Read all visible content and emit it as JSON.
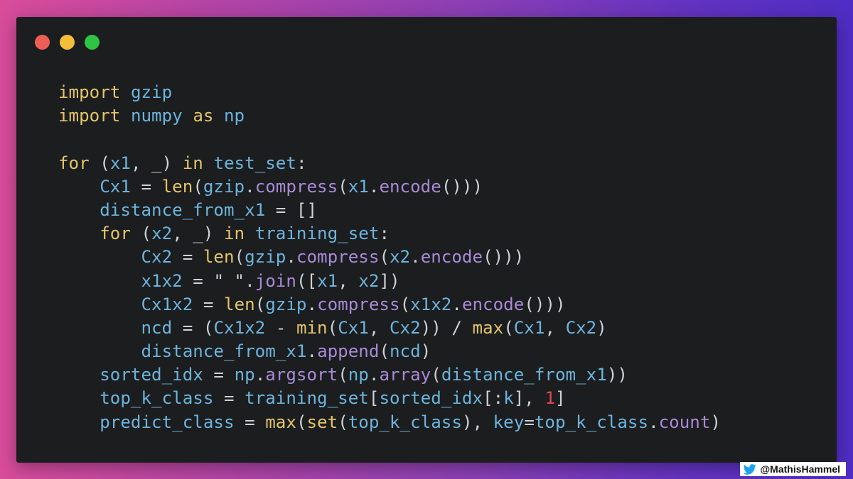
{
  "window": {
    "traffic_lights": [
      {
        "name": "close",
        "color": "#ed5f56"
      },
      {
        "name": "minimize",
        "color": "#f4bd3a"
      },
      {
        "name": "zoom",
        "color": "#2fc443"
      }
    ]
  },
  "code": {
    "lines": [
      [
        {
          "t": "import",
          "c": "kw"
        },
        {
          "t": " ",
          "c": "pn"
        },
        {
          "t": "gzip",
          "c": "id"
        }
      ],
      [
        {
          "t": "import",
          "c": "kw"
        },
        {
          "t": " ",
          "c": "pn"
        },
        {
          "t": "numpy",
          "c": "id"
        },
        {
          "t": " ",
          "c": "pn"
        },
        {
          "t": "as",
          "c": "kw"
        },
        {
          "t": " ",
          "c": "pn"
        },
        {
          "t": "np",
          "c": "id"
        }
      ],
      [],
      [
        {
          "t": "for",
          "c": "kw"
        },
        {
          "t": " (",
          "c": "pn"
        },
        {
          "t": "x1",
          "c": "id"
        },
        {
          "t": ", _) ",
          "c": "pn"
        },
        {
          "t": "in",
          "c": "kw"
        },
        {
          "t": " ",
          "c": "pn"
        },
        {
          "t": "test_set",
          "c": "id"
        },
        {
          "t": ":",
          "c": "pn"
        }
      ],
      [
        {
          "t": "    ",
          "c": "pn"
        },
        {
          "t": "Cx1",
          "c": "id"
        },
        {
          "t": " = ",
          "c": "pn"
        },
        {
          "t": "len",
          "c": "kw"
        },
        {
          "t": "(",
          "c": "pn"
        },
        {
          "t": "gzip",
          "c": "id"
        },
        {
          "t": ".",
          "c": "pn"
        },
        {
          "t": "compress",
          "c": "fn"
        },
        {
          "t": "(",
          "c": "pn"
        },
        {
          "t": "x1",
          "c": "id"
        },
        {
          "t": ".",
          "c": "pn"
        },
        {
          "t": "encode",
          "c": "fn"
        },
        {
          "t": "()))",
          "c": "pn"
        }
      ],
      [
        {
          "t": "    ",
          "c": "pn"
        },
        {
          "t": "distance_from_x1",
          "c": "id"
        },
        {
          "t": " = []",
          "c": "pn"
        }
      ],
      [
        {
          "t": "    ",
          "c": "pn"
        },
        {
          "t": "for",
          "c": "kw"
        },
        {
          "t": " (",
          "c": "pn"
        },
        {
          "t": "x2",
          "c": "id"
        },
        {
          "t": ", _) ",
          "c": "pn"
        },
        {
          "t": "in",
          "c": "kw"
        },
        {
          "t": " ",
          "c": "pn"
        },
        {
          "t": "training_set",
          "c": "id"
        },
        {
          "t": ":",
          "c": "pn"
        }
      ],
      [
        {
          "t": "        ",
          "c": "pn"
        },
        {
          "t": "Cx2",
          "c": "id"
        },
        {
          "t": " = ",
          "c": "pn"
        },
        {
          "t": "len",
          "c": "kw"
        },
        {
          "t": "(",
          "c": "pn"
        },
        {
          "t": "gzip",
          "c": "id"
        },
        {
          "t": ".",
          "c": "pn"
        },
        {
          "t": "compress",
          "c": "fn"
        },
        {
          "t": "(",
          "c": "pn"
        },
        {
          "t": "x2",
          "c": "id"
        },
        {
          "t": ".",
          "c": "pn"
        },
        {
          "t": "encode",
          "c": "fn"
        },
        {
          "t": "()))",
          "c": "pn"
        }
      ],
      [
        {
          "t": "        ",
          "c": "pn"
        },
        {
          "t": "x1x2",
          "c": "id"
        },
        {
          "t": " = ",
          "c": "pn"
        },
        {
          "t": "\" \"",
          "c": "st"
        },
        {
          "t": ".",
          "c": "pn"
        },
        {
          "t": "join",
          "c": "fn"
        },
        {
          "t": "([",
          "c": "pn"
        },
        {
          "t": "x1",
          "c": "id"
        },
        {
          "t": ", ",
          "c": "pn"
        },
        {
          "t": "x2",
          "c": "id"
        },
        {
          "t": "])",
          "c": "pn"
        }
      ],
      [
        {
          "t": "        ",
          "c": "pn"
        },
        {
          "t": "Cx1x2",
          "c": "id"
        },
        {
          "t": " = ",
          "c": "pn"
        },
        {
          "t": "len",
          "c": "kw"
        },
        {
          "t": "(",
          "c": "pn"
        },
        {
          "t": "gzip",
          "c": "id"
        },
        {
          "t": ".",
          "c": "pn"
        },
        {
          "t": "compress",
          "c": "fn"
        },
        {
          "t": "(",
          "c": "pn"
        },
        {
          "t": "x1x2",
          "c": "id"
        },
        {
          "t": ".",
          "c": "pn"
        },
        {
          "t": "encode",
          "c": "fn"
        },
        {
          "t": "()))",
          "c": "pn"
        }
      ],
      [
        {
          "t": "        ",
          "c": "pn"
        },
        {
          "t": "ncd",
          "c": "id"
        },
        {
          "t": " = (",
          "c": "pn"
        },
        {
          "t": "Cx1x2",
          "c": "id"
        },
        {
          "t": " - ",
          "c": "pn"
        },
        {
          "t": "min",
          "c": "kw"
        },
        {
          "t": "(",
          "c": "pn"
        },
        {
          "t": "Cx1",
          "c": "id"
        },
        {
          "t": ", ",
          "c": "pn"
        },
        {
          "t": "Cx2",
          "c": "id"
        },
        {
          "t": ")) / ",
          "c": "pn"
        },
        {
          "t": "max",
          "c": "kw"
        },
        {
          "t": "(",
          "c": "pn"
        },
        {
          "t": "Cx1",
          "c": "id"
        },
        {
          "t": ", ",
          "c": "pn"
        },
        {
          "t": "Cx2",
          "c": "id"
        },
        {
          "t": ")",
          "c": "pn"
        }
      ],
      [
        {
          "t": "        ",
          "c": "pn"
        },
        {
          "t": "distance_from_x1",
          "c": "id"
        },
        {
          "t": ".",
          "c": "pn"
        },
        {
          "t": "append",
          "c": "fn"
        },
        {
          "t": "(",
          "c": "pn"
        },
        {
          "t": "ncd",
          "c": "id"
        },
        {
          "t": ")",
          "c": "pn"
        }
      ],
      [
        {
          "t": "    ",
          "c": "pn"
        },
        {
          "t": "sorted_idx",
          "c": "id"
        },
        {
          "t": " = ",
          "c": "pn"
        },
        {
          "t": "np",
          "c": "id"
        },
        {
          "t": ".",
          "c": "pn"
        },
        {
          "t": "argsort",
          "c": "fn"
        },
        {
          "t": "(",
          "c": "pn"
        },
        {
          "t": "np",
          "c": "id"
        },
        {
          "t": ".",
          "c": "pn"
        },
        {
          "t": "array",
          "c": "fn"
        },
        {
          "t": "(",
          "c": "pn"
        },
        {
          "t": "distance_from_x1",
          "c": "id"
        },
        {
          "t": "))",
          "c": "pn"
        }
      ],
      [
        {
          "t": "    ",
          "c": "pn"
        },
        {
          "t": "top_k_class",
          "c": "id"
        },
        {
          "t": " = ",
          "c": "pn"
        },
        {
          "t": "training_set",
          "c": "id"
        },
        {
          "t": "[",
          "c": "pn"
        },
        {
          "t": "sorted_idx",
          "c": "id"
        },
        {
          "t": "[:",
          "c": "pn"
        },
        {
          "t": "k",
          "c": "id"
        },
        {
          "t": "], ",
          "c": "pn"
        },
        {
          "t": "1",
          "c": "nm"
        },
        {
          "t": "]",
          "c": "pn"
        }
      ],
      [
        {
          "t": "    ",
          "c": "pn"
        },
        {
          "t": "predict_class",
          "c": "id"
        },
        {
          "t": " = ",
          "c": "pn"
        },
        {
          "t": "max",
          "c": "kw"
        },
        {
          "t": "(",
          "c": "pn"
        },
        {
          "t": "set",
          "c": "kw"
        },
        {
          "t": "(",
          "c": "pn"
        },
        {
          "t": "top_k_class",
          "c": "id"
        },
        {
          "t": "), ",
          "c": "pn"
        },
        {
          "t": "key",
          "c": "id"
        },
        {
          "t": "=",
          "c": "pn"
        },
        {
          "t": "top_k_class",
          "c": "id"
        },
        {
          "t": ".",
          "c": "pn"
        },
        {
          "t": "count",
          "c": "fn"
        },
        {
          "t": ")",
          "c": "pn"
        }
      ]
    ]
  },
  "credit": {
    "icon": "twitter-bird-icon",
    "handle": "@MathisHammel"
  }
}
